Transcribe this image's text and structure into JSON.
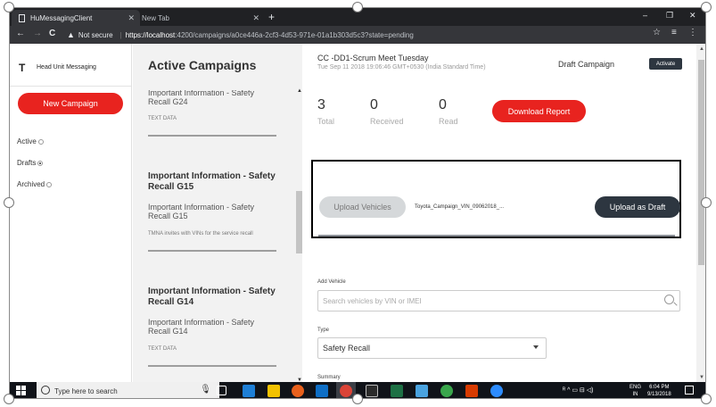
{
  "browser": {
    "tabs": [
      {
        "label": "HuMessagingClient"
      },
      {
        "label": "New Tab"
      }
    ],
    "new_tab": "+",
    "controls": {
      "minimize": "–",
      "maximize": "❐",
      "close": "✕"
    },
    "nav": {
      "back": "←",
      "forward": "→",
      "reload": "C"
    },
    "security_label": "Not secure",
    "url_host": "https://localhost",
    "url_rest": ":4200/campaigns/a0ce446a-2cf3-4d53-971e-01a1b303d5c3?state=pending",
    "star": "☆",
    "menu": "⋮",
    "ext": "≡"
  },
  "sidebar": {
    "logo": "T",
    "app_name": "Head Unit Messaging",
    "new_campaign": "New Campaign",
    "filters": [
      {
        "label": "Active",
        "selected": false
      },
      {
        "label": "Drafts",
        "selected": true
      },
      {
        "label": "Archived",
        "selected": false
      }
    ]
  },
  "campaign_list": {
    "title": "Active Campaigns",
    "cards": [
      {
        "title": "",
        "subtitle": "Important Information - Safety Recall G24",
        "meta": "TEXT DATA"
      },
      {
        "title": "Important Information - Safety Recall G15",
        "subtitle": "Important Information - Safety Recall G15",
        "meta": "TMNA invites with VINs for the service recall"
      },
      {
        "title": "Important Information - Safety Recall G14",
        "subtitle": "Important Information - Safety Recall G14",
        "meta": "TEXT DATA"
      }
    ],
    "scroll_up": "▲",
    "scroll_down": "▼"
  },
  "detail": {
    "campaign_title": "CC -DD1-Scrum Meet Tuesday",
    "campaign_date": "Tue Sep 11 2018 19:06:46 GMT+0530 (India Standard Time)",
    "status_label": "Draft Campaign",
    "activate": "Activate",
    "stats": [
      {
        "value": "3",
        "label": "Total"
      },
      {
        "value": "0",
        "label": "Received"
      },
      {
        "value": "0",
        "label": "Read"
      }
    ],
    "download_report": "Download Report",
    "upload_vehicles": "Upload Vehicles",
    "file_name": "Toyota_Campaign_VIN_09062018_...",
    "upload_as_draft": "Upload as Draft",
    "add_vehicle_label": "Add Vehicle",
    "search_placeholder": "Search vehicles by VIN or IMEI",
    "type_label": "Type",
    "type_value": "Safety Recall",
    "summary_label": "Summary"
  },
  "taskbar": {
    "search_placeholder": "Type here to search",
    "ime": "ENG\nIN",
    "lang_top": "ENG",
    "lang_bottom": "IN",
    "time": "6:04 PM",
    "date": "9/13/2018",
    "tray_text": "ᴿ ^ ▭ ⊟ ◁)"
  }
}
